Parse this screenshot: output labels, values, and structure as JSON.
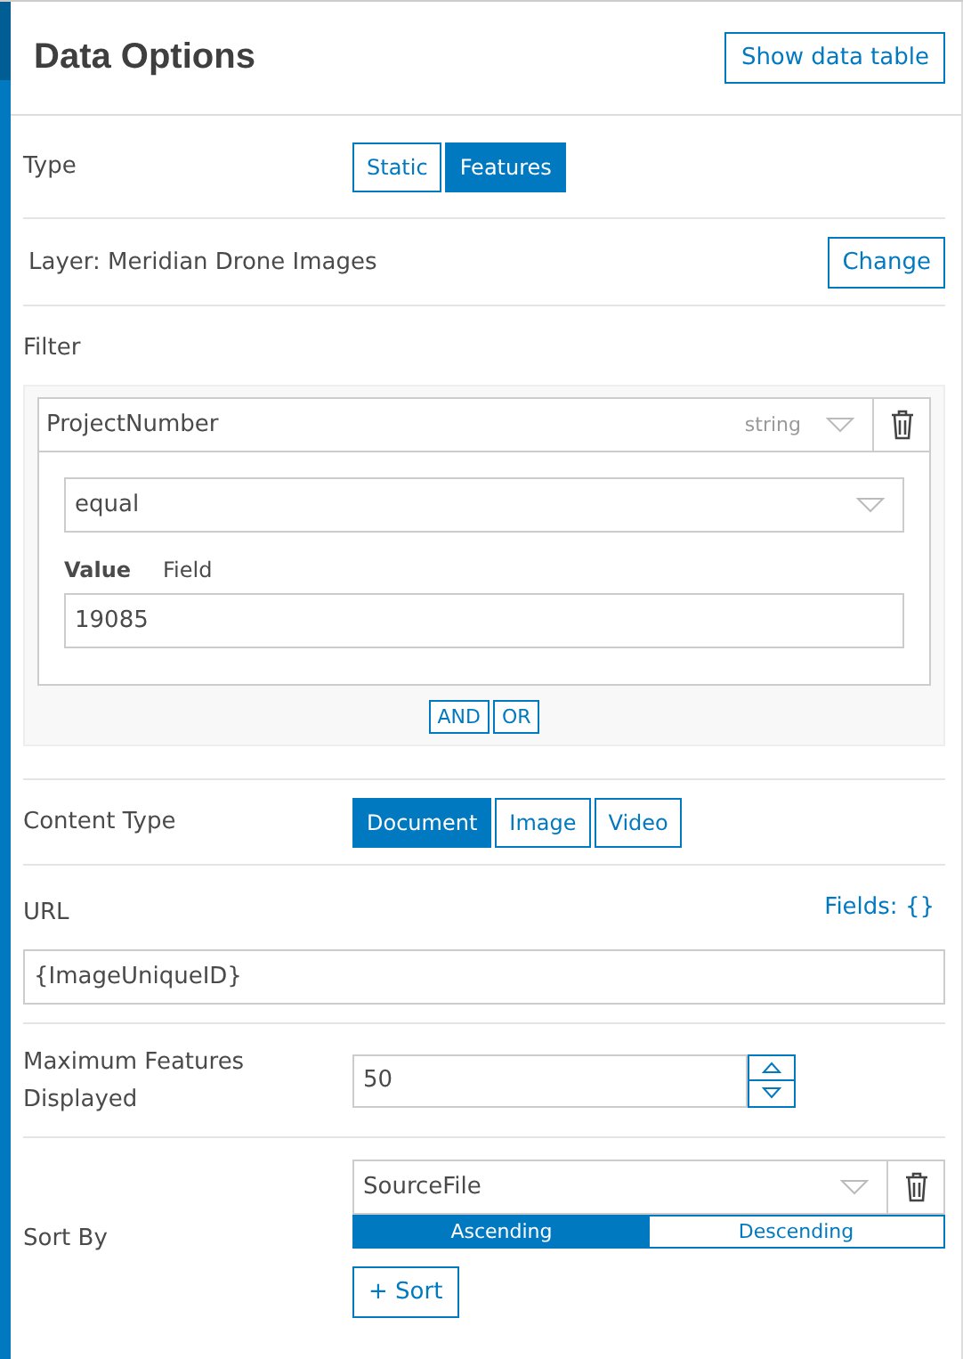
{
  "header": {
    "title": "Data Options",
    "button": "Show data table"
  },
  "type": {
    "label": "Type",
    "options": [
      {
        "label": "Static",
        "selected": false
      },
      {
        "label": "Features",
        "selected": true
      }
    ]
  },
  "layer": {
    "label": "Layer: Meridian Drone Images",
    "button": "Change"
  },
  "filter": {
    "label": "Filter",
    "field": "ProjectNumber",
    "field_type": "string",
    "operator": "equal",
    "value_tabs": [
      {
        "label": "Value",
        "selected": true
      },
      {
        "label": "Field",
        "selected": false
      }
    ],
    "value": "19085",
    "joins": [
      "AND",
      "OR"
    ]
  },
  "content_type": {
    "label": "Content Type",
    "options": [
      {
        "label": "Document",
        "selected": true
      },
      {
        "label": "Image",
        "selected": false
      },
      {
        "label": "Video",
        "selected": false
      }
    ]
  },
  "url": {
    "label": "URL",
    "fields_link": "Fields: {}",
    "value": "{ImageUniqueID}"
  },
  "max_features": {
    "label": "Maximum Features Displayed",
    "value": "50"
  },
  "sort": {
    "label": "Sort By",
    "field": "SourceFile",
    "orders": [
      {
        "label": "Ascending",
        "selected": true
      },
      {
        "label": "Descending",
        "selected": false
      }
    ],
    "add_button": "+ Sort"
  }
}
